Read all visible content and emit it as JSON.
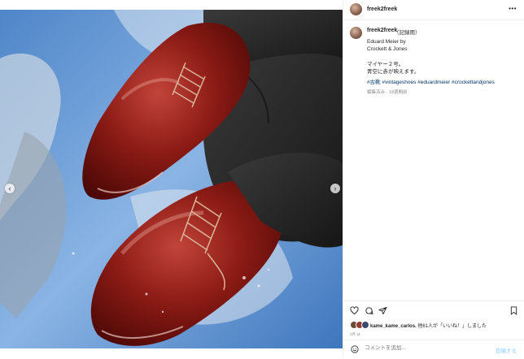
{
  "post": {
    "username": "freek2freek",
    "caption": {
      "username": "freek2freek",
      "tag": "（記録用）",
      "lines": [
        "Eduard Meier by",
        "Crockett & Jones",
        "マイヤー２号。",
        "青空に赤が映えます。"
      ],
      "hashtags": "#古靴 #vintageshoes #eduardmeier #crockettandjones",
      "meta": "編集済み · 18週間前"
    },
    "likes": {
      "text_user": "kame_kame_carlos.",
      "text_rest": " 他61人が「いいね！」しました"
    },
    "date": "2月 11",
    "comment": {
      "placeholder": "コメントを追加...",
      "post_label": "投稿する"
    }
  },
  "carousel": {
    "prev": "‹",
    "next": "›",
    "dot_count": 2,
    "active_index": 0
  },
  "colors": {
    "accent": "#3897f0",
    "link": "#00376b",
    "post_button": "#b2dffc",
    "shoe": "#7a1410"
  },
  "icons": [
    "heart-icon",
    "comment-icon",
    "share-icon",
    "bookmark-icon",
    "emoji-icon",
    "more-icon"
  ]
}
